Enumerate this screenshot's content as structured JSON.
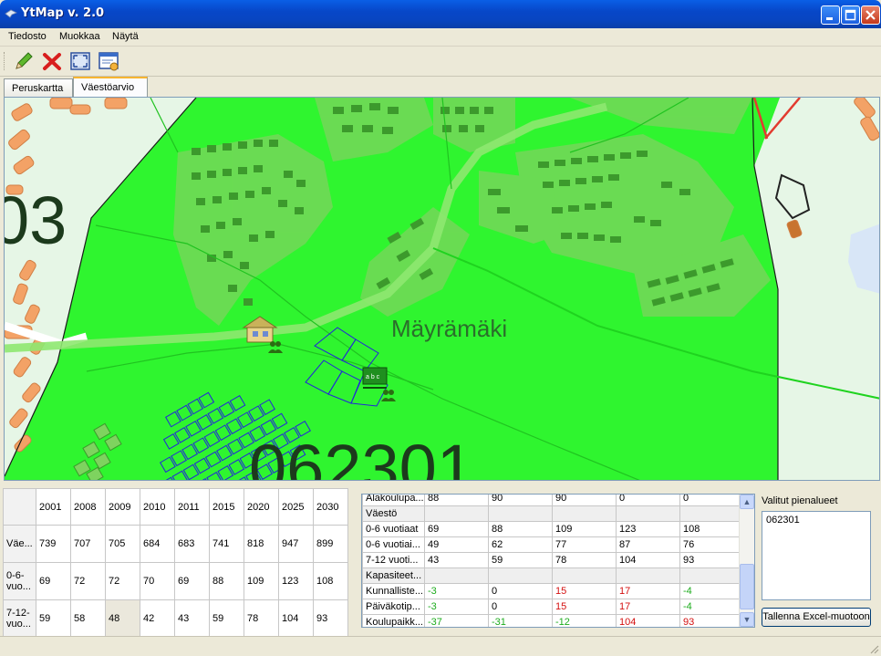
{
  "window": {
    "title": "YtMap v. 2.0"
  },
  "menu": [
    "Tiedosto",
    "Muokkaa",
    "Näytä"
  ],
  "toolbar": {
    "icons": [
      "pencil-icon",
      "delete-icon",
      "zoom-extent-icon",
      "properties-icon"
    ]
  },
  "tabs": [
    {
      "label": "Peruskartta",
      "active": false
    },
    {
      "label": "Väestöarvio",
      "active": true
    }
  ],
  "map": {
    "area_name": "Mäyrämäki",
    "area_code": "062301",
    "neighbor_code_fragment": "03",
    "colors": {
      "selected_area": "#2ff52f",
      "land": "#e6f6e6",
      "buildings": "#f3a266",
      "water": "#d8e6f7"
    }
  },
  "left_table": {
    "years": [
      "2001",
      "2008",
      "2009",
      "2010",
      "2011",
      "2015",
      "2020",
      "2025",
      "2030"
    ],
    "rows": [
      {
        "label": "Väe...",
        "values": [
          "739",
          "707",
          "705",
          "684",
          "683",
          "741",
          "818",
          "947",
          "899"
        ]
      },
      {
        "label": "0-6-vuo...",
        "values": [
          "69",
          "72",
          "72",
          "70",
          "69",
          "88",
          "109",
          "123",
          "108"
        ]
      },
      {
        "label": "7-12-vuo...",
        "values": [
          "59",
          "58",
          "48",
          "42",
          "43",
          "59",
          "78",
          "104",
          "93"
        ]
      }
    ]
  },
  "right_table": {
    "rows": [
      {
        "label": "Alakoulupa...",
        "values": [
          "88",
          "90",
          "90",
          "0",
          "0"
        ],
        "section": false
      },
      {
        "label": "Väestö",
        "values": [
          "",
          "",
          "",
          "",
          ""
        ],
        "section": true
      },
      {
        "label": "0-6 vuotiaat",
        "values": [
          "69",
          "88",
          "109",
          "123",
          "108"
        ],
        "section": false
      },
      {
        "label": "0-6 vuotiai...",
        "values": [
          "49",
          "62",
          "77",
          "87",
          "76"
        ],
        "section": false
      },
      {
        "label": "7-12 vuoti...",
        "values": [
          "43",
          "59",
          "78",
          "104",
          "93"
        ],
        "section": false
      },
      {
        "label": "Kapasiteet...",
        "values": [
          "",
          "",
          "",
          "",
          ""
        ],
        "section": true
      },
      {
        "label": "Kunnalliste...",
        "values": [
          "-3",
          "0",
          "15",
          "17",
          "-4"
        ],
        "section": false,
        "colors": [
          "pos",
          "",
          "neg",
          "neg",
          "pos"
        ]
      },
      {
        "label": "Päiväkotip...",
        "values": [
          "-3",
          "0",
          "15",
          "17",
          "-4"
        ],
        "section": false,
        "colors": [
          "pos",
          "",
          "neg",
          "neg",
          "pos"
        ]
      },
      {
        "label": "Koulupaikk...",
        "values": [
          "-37",
          "-31",
          "-12",
          "104",
          "93"
        ],
        "section": false,
        "colors": [
          "pos",
          "pos",
          "pos",
          "neg",
          "neg"
        ]
      }
    ]
  },
  "side": {
    "label": "Valitut pienalueet",
    "items": [
      "062301"
    ],
    "export_button": "Tallenna Excel-muotoon"
  }
}
